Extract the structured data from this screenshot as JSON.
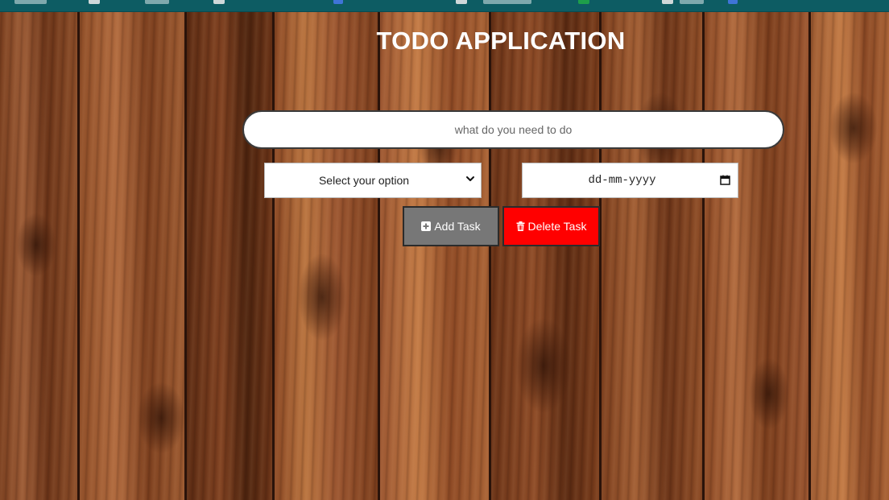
{
  "app": {
    "title": "TODO APPLICATION"
  },
  "task_input": {
    "placeholder": "what do you need to do",
    "value": ""
  },
  "category_select": {
    "selected": "Select your option"
  },
  "date_input": {
    "value": "dd-mm-yyyy"
  },
  "buttons": {
    "add_label": "Add Task",
    "delete_label": "Delete Task"
  },
  "colors": {
    "add_button": "#777777",
    "delete_button": "#ff0000",
    "title": "#ffffff",
    "browser_bar": "#0d5c63"
  },
  "icons": {
    "add": "plus-square-icon",
    "delete": "trash-icon",
    "select": "chevron-down-icon",
    "date": "calendar-icon"
  }
}
